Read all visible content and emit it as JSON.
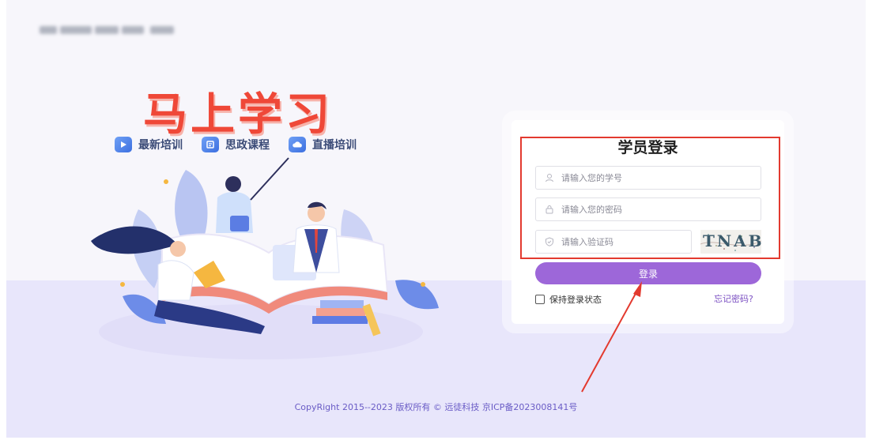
{
  "branding": {
    "title": "马上学习",
    "logo_text_blurred": ""
  },
  "features": [
    {
      "label": "最新培训",
      "icon": "play-icon"
    },
    {
      "label": "思政课程",
      "icon": "document-edit-icon"
    },
    {
      "label": "直播培训",
      "icon": "cloud-icon"
    }
  ],
  "login": {
    "title": "学员登录",
    "student_id": {
      "placeholder": "请输入您的学号",
      "value": "",
      "icon": "user-icon"
    },
    "password": {
      "placeholder": "请输入您的密码",
      "value": "",
      "icon": "lock-icon"
    },
    "captcha": {
      "placeholder": "请输入验证码",
      "value": "",
      "icon": "shield-icon",
      "image_text": "TNAB"
    },
    "submit_label": "登录",
    "remember_label": "保持登录状态",
    "remember_checked": false,
    "forgot_label": "忘记密码?"
  },
  "footer": {
    "text": "CopyRight 2015--2023 版权所有 © 远徒科技 京ICP备2023008141号"
  },
  "colors": {
    "brand_red": "#ef4838",
    "button_purple": "#9d67d9",
    "annotation_red": "#e33a2f",
    "footer_text": "#6a5cc6"
  }
}
